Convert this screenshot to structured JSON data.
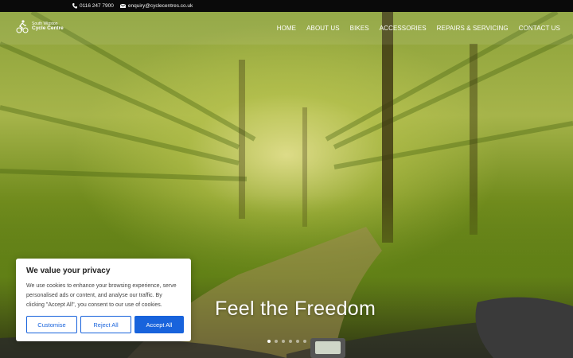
{
  "topbar": {
    "phone": "0116 247 7900",
    "email": "enquiry@cyclecentres.co.uk",
    "phone_icon": "phone-icon",
    "email_icon": "envelope-icon"
  },
  "header": {
    "logo": {
      "line1": "South Wigston",
      "line2": "Cycle Centre",
      "icon": "cyclist-icon"
    },
    "nav": [
      {
        "label": "HOME",
        "active": true
      },
      {
        "label": "ABOUT US"
      },
      {
        "label": "BIKES"
      },
      {
        "label": "ACCESSORIES"
      },
      {
        "label": "REPAIRS & SERVICING"
      },
      {
        "label": "CONTACT US"
      }
    ]
  },
  "hero": {
    "caption": "Feel the Freedom",
    "slides": 6,
    "active_slide": 1
  },
  "cookie": {
    "title": "We value your privacy",
    "body": "We use cookies to enhance your browsing experience, serve personalised ads or content, and analyse our traffic. By clicking \"Accept All\", you consent to our use of cookies.",
    "customise": "Customise",
    "reject": "Reject All",
    "accept": "Accept All"
  },
  "colors": {
    "accent": "#1863dc",
    "topbar": "#0a0a0a"
  }
}
